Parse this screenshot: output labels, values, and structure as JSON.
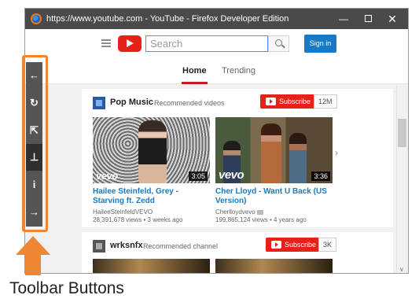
{
  "window": {
    "title": "https://www.youtube.com - YouTube - Firefox Developer Edition",
    "controls": {
      "minimize": "—",
      "close": "✕"
    }
  },
  "header": {
    "search_placeholder": "Search",
    "signin_label": "Sign in"
  },
  "tabs": [
    {
      "label": "Home",
      "active": true
    },
    {
      "label": "Trending",
      "active": false
    }
  ],
  "sections": [
    {
      "channel": "Pop Music",
      "subtitle": "Recommended videos",
      "subscribe_label": "Subscribe",
      "subscriber_count": "12M",
      "videos": [
        {
          "title": "Hailee Steinfeld, Grey - Starving ft. Zedd",
          "channel": "HaileeSteinfeldVEVO",
          "views": "28,391,678 views",
          "age": "3 weeks ago",
          "duration": "3:05",
          "brand": "vevo"
        },
        {
          "title": "Cher Lloyd - Want U Back (US Version)",
          "channel": "Cherlloydvevo",
          "views": "199,865,124 views",
          "age": "4 years ago",
          "duration": "3:36",
          "brand": "vevo"
        }
      ]
    },
    {
      "channel": "wrksnfx",
      "subtitle": "Recommended channel",
      "subscribe_label": "Subscribe",
      "subscriber_count": "3K"
    }
  ],
  "toolbar": {
    "buttons": [
      {
        "icon": "arrow-left-icon",
        "glyph": "←"
      },
      {
        "icon": "reload-icon",
        "glyph": "↻"
      },
      {
        "icon": "open-external-icon",
        "glyph": "⇱"
      },
      {
        "icon": "pin-icon",
        "glyph": "⊥",
        "active": true
      },
      {
        "icon": "info-icon",
        "glyph": "i"
      },
      {
        "icon": "arrow-right-icon",
        "glyph": "→"
      }
    ]
  },
  "callout": {
    "caption": "Toolbar Buttons"
  },
  "colors": {
    "accent_orange": "#ee8633",
    "youtube_red": "#e62117",
    "link_blue": "#167ac6",
    "toolbar_gray": "#555555"
  }
}
